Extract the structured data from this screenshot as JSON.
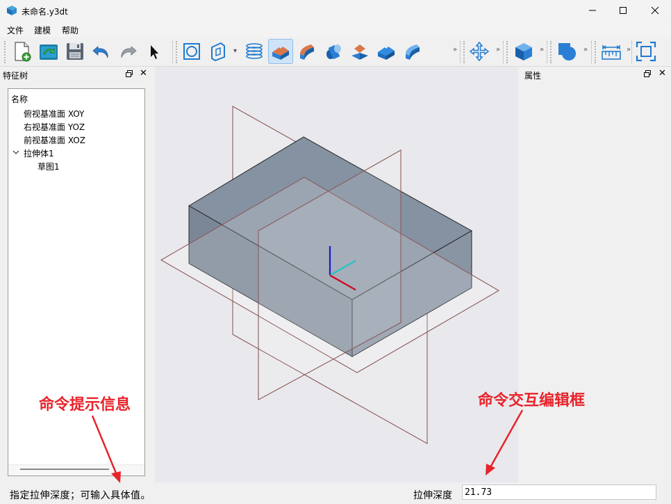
{
  "window": {
    "title": "未命名.y3dt",
    "controls": [
      "minimize-icon",
      "maximize-icon",
      "close-icon"
    ]
  },
  "menu": {
    "items": [
      {
        "label": "文件"
      },
      {
        "label": "建模"
      },
      {
        "label": "帮助"
      }
    ]
  },
  "toolbar": {
    "groups": [
      [
        "new-file-icon",
        "open-file-icon",
        "save-icon",
        "undo-icon",
        "redo-icon",
        "select-cursor-icon"
      ],
      [
        "circle-sketch-icon",
        "plane-sketch-icon",
        "helix-icon",
        "extrude-icon",
        "revolve-icon",
        "sweep-icon",
        "loft-icon",
        "cut-extrude-icon",
        "cut-revolve-icon"
      ],
      [
        "move-icon"
      ],
      [
        "box-icon"
      ],
      [
        "boolean-icon"
      ],
      [
        "measure-icon"
      ],
      [
        "fit-view-icon"
      ]
    ],
    "active": "extrude-icon",
    "colors": {
      "accent_blue": "#2a7fd4",
      "accent_orange": "#d9774a"
    }
  },
  "feature_tree": {
    "title": "特征树",
    "column": "名称",
    "nodes": [
      {
        "label": "俯视基准面 XOY"
      },
      {
        "label": "右视基准面 YOZ"
      },
      {
        "label": "前视基准面 XOZ"
      },
      {
        "label": "拉伸体1"
      },
      {
        "label": "草图1"
      }
    ]
  },
  "properties": {
    "title": "属性"
  },
  "viewport": {
    "colors": {
      "background": "#e9e9ed",
      "solid_top": "#8592a2",
      "solid_front": "#7b8797",
      "solid_side": "#8a95a4",
      "plane_edge": "#8a5a5a",
      "axis_x": "#d0021b",
      "axis_y": "#21c4c4",
      "axis_z": "#1a1acc"
    }
  },
  "status": {
    "message": "指定拉伸深度；可输入具体值。",
    "command_label": "拉伸深度",
    "command_value": "21.73"
  },
  "annotations": {
    "left": "命令提示信息",
    "right": "命令交互编辑框",
    "color": "#e8232a"
  }
}
